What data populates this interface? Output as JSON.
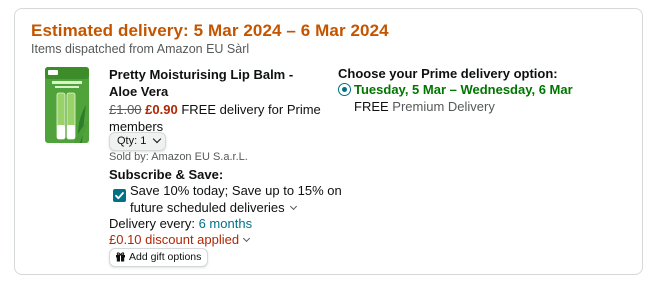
{
  "delivery": {
    "estimate": "Estimated delivery: 5 Mar 2024 – 6 Mar 2024",
    "dispatch": "Items dispatched from Amazon EU Sàrl"
  },
  "product": {
    "title": "Pretty Moisturising Lip Balm - Aloe Vera",
    "old_price": "£1.00",
    "new_price": "£0.90",
    "delivery_note": "FREE delivery for Prime members",
    "qty_label": "Qty:",
    "qty_value": "1",
    "sold_by": "Sold by: Amazon EU S.a.r.L.",
    "image_icon": "lip-balm-product-image"
  },
  "subscribe": {
    "title": "Subscribe & Save:",
    "save_text": "Save 10% today; Save up to 15% on future scheduled deliveries",
    "checked": true,
    "every_label": "Delivery every:",
    "every_value": "6 months",
    "discount": "£0.10 discount applied",
    "gift_label": "Add gift options"
  },
  "prime": {
    "heading": "Choose your Prime delivery option:",
    "option_date": "Tuesday, 5 Mar – Wednesday, 6 Mar",
    "option_free": "FREE",
    "option_type": "Premium Delivery"
  },
  "colors": {
    "estimate": "#c45500",
    "price": "#b12704",
    "link": "#007185",
    "prime_date": "#007600"
  }
}
